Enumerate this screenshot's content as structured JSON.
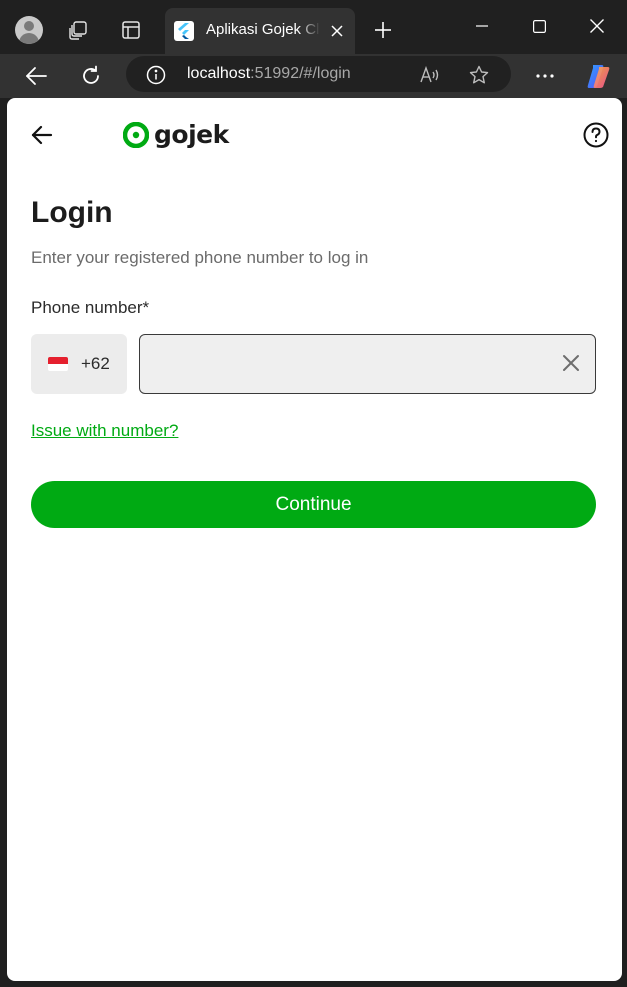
{
  "browser": {
    "tab": {
      "title": "Aplikasi Gojek Clone"
    },
    "address": {
      "host": "localhost",
      "rest": ":51992/#/login"
    },
    "icons": {
      "profile": "profile-avatar-icon",
      "workspaces": "workspaces-icon",
      "tab_actions": "tab-actions-icon",
      "favicon": "flutter-favicon-icon",
      "tab_close": "close-icon",
      "new_tab": "plus-icon",
      "minimize": "minimize-icon",
      "maximize": "maximize-icon",
      "close_window": "close-icon",
      "back": "arrow-left-icon",
      "refresh": "refresh-icon",
      "site_info": "info-icon",
      "read_aloud": "read-aloud-icon",
      "favorite": "star-icon",
      "more": "more-horizontal-icon",
      "copilot": "copilot-icon"
    }
  },
  "header": {
    "logo_text": "gojek",
    "back_icon": "arrow-left-icon",
    "help_icon": "help-circle-icon"
  },
  "login": {
    "title": "Login",
    "subtitle": "Enter your registered phone number to log in",
    "phone_label": "Phone number*",
    "country": {
      "flag": "indonesia-flag-icon",
      "dial_code": "+62"
    },
    "phone_value": "",
    "phone_placeholder": "",
    "issue_link": "Issue with number?",
    "continue_label": "Continue"
  },
  "colors": {
    "brand_green": "#00AA13",
    "text_primary": "#1C1C1C",
    "text_secondary": "#6B6B6B",
    "input_bg": "#EFEFEF",
    "browser_dark": "#202020"
  }
}
